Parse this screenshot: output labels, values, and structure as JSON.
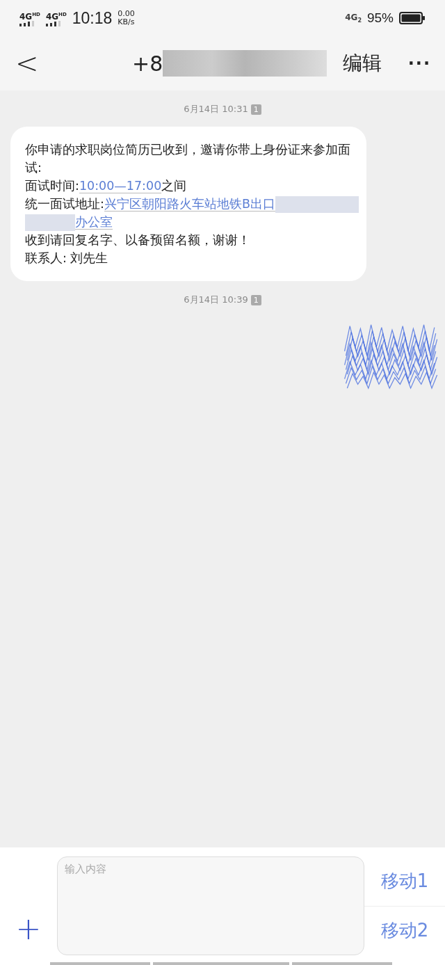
{
  "status_bar": {
    "signals": [
      {
        "label": "4G",
        "sup": "HD"
      },
      {
        "label": "4G",
        "sup": "HD"
      }
    ],
    "time": "10:18",
    "speed_value": "0.00",
    "speed_unit": "KB/s",
    "sim_label": "4G",
    "sim_sub": "2",
    "battery": "95%"
  },
  "header": {
    "back": "<",
    "title": "+8",
    "title_redacted": true,
    "edit": "编辑",
    "more": "···"
  },
  "messages": [
    {
      "kind": "received",
      "timestamp": "6月14日 10:31",
      "sim": "1",
      "lines": [
        [
          {
            "kind": "text",
            "text": "你申请的求职岗位简历已收到，邀请你带上身份证来参加面试:"
          }
        ],
        [
          {
            "kind": "text",
            "text": "面试时间:"
          },
          {
            "kind": "link",
            "text": "10:00—17:00"
          },
          {
            "kind": "text",
            "text": "之间"
          }
        ],
        [
          {
            "kind": "text",
            "text": "统一面试地址:"
          },
          {
            "kind": "link",
            "text": "兴宁区朝阳路火车站地铁B出口"
          },
          {
            "kind": "blur"
          }
        ],
        [
          {
            "kind": "blur"
          },
          {
            "kind": "link",
            "text": "办公室"
          }
        ],
        [
          {
            "kind": "text",
            "text": "收到请回复名字、以备预留名额，谢谢！"
          }
        ],
        [
          {
            "kind": "text",
            "text": "联系人: 刘先生"
          }
        ]
      ]
    },
    {
      "kind": "scribbled",
      "timestamp": "6月14日 10:39",
      "sim": "1"
    }
  ],
  "composer": {
    "plus": "+",
    "placeholder": "输入内容",
    "send_buttons": [
      "移动1",
      "移动2"
    ]
  }
}
